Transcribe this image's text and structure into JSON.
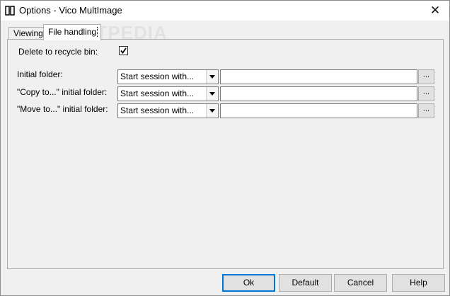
{
  "window": {
    "title": "Options - Vico MultImage",
    "close_glyph": "✕"
  },
  "watermark": "SOFTPEDIA",
  "tabs": [
    {
      "label": "Viewing",
      "active": false
    },
    {
      "label": "File handling",
      "active": true
    }
  ],
  "file_handling": {
    "recycle_label": "Delete to recycle bin:",
    "recycle_checked": true,
    "rows": [
      {
        "label": "Initial folder:",
        "select_value": "Start session with...",
        "path": "",
        "browse_label": "..."
      },
      {
        "label": "\"Copy to...\" initial folder:",
        "select_value": "Start session with...",
        "path": "",
        "browse_label": "..."
      },
      {
        "label": "\"Move to...\" initial folder:",
        "select_value": "Start session with...",
        "path": "",
        "browse_label": "..."
      }
    ]
  },
  "buttons": {
    "ok": "Ok",
    "default": "Default",
    "cancel": "Cancel",
    "help": "Help"
  }
}
